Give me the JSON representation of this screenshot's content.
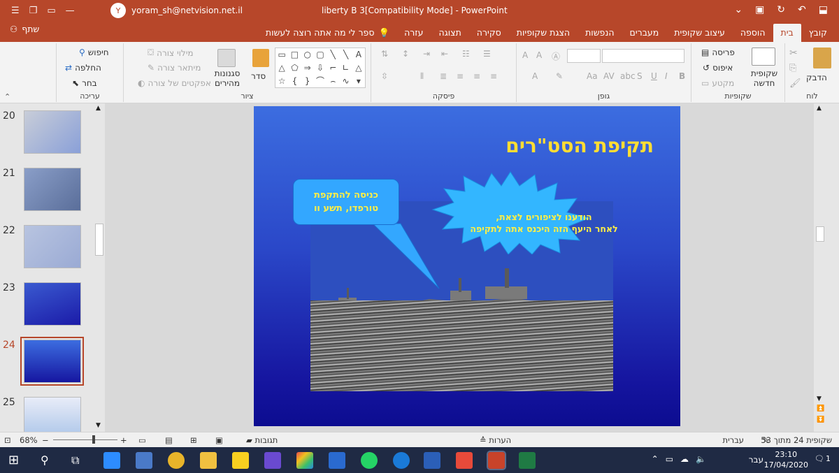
{
  "window": {
    "title": "liberty B 3[Compatibility Mode]  -  PowerPoint",
    "user_initial": "Y",
    "user_email": "yoram_sh@netvision.net.il"
  },
  "ribbon_tabs": [
    "קובץ",
    "בית",
    "הוספה",
    "עיצוב שקופית",
    "מעברים",
    "הנפשות",
    "הצגת שקופיות",
    "סקירה",
    "תצוגה",
    "עזרה"
  ],
  "active_tab": "בית",
  "tell_me": "ספר לי מה אתה רוצה לעשות",
  "share_label": "שתף",
  "groups": {
    "clipboard": {
      "label": "לוח",
      "paste": "הדבק"
    },
    "slides": {
      "label": "שקופיות",
      "new_slide": "שקופית חדשה",
      "layout": "פריסה",
      "reset": "איפוס",
      "section": "מקטע"
    },
    "font": {
      "label": "גופן"
    },
    "paragraph": {
      "label": "פיסקה"
    },
    "drawing": {
      "label": "ציור",
      "arrange": "סדר",
      "quick_styles": "סגנונות מהירים",
      "shape_fill": "מילוי צורה",
      "shape_outline": "מיתאר צורה",
      "shape_effects": "אפקטים של צורה"
    },
    "editing": {
      "label": "עריכה",
      "find": "חיפוש",
      "replace": "החלפה",
      "select": "בחר"
    }
  },
  "thumbnails": [
    {
      "num": "20"
    },
    {
      "num": "21"
    },
    {
      "num": "22"
    },
    {
      "num": "23"
    },
    {
      "num": "24"
    },
    {
      "num": "25"
    }
  ],
  "selected_slide": "24",
  "slide": {
    "title": "תקיפת הסט\"רים",
    "callout_line1": "כניסה להתקפת",
    "callout_line2": "טורפדו, תשע וו",
    "burst_line1": "הודענו לציפורים לצאת,",
    "burst_line2": "לאחר היעף הזה היכנס אתה לתקיפה"
  },
  "status": {
    "slide_counter": "שקופית 24 מתוך 53",
    "language": "עברית",
    "notes": "הערות",
    "comments": "תגובות",
    "zoom": "68%"
  },
  "taskbar": {
    "lang": "עבר",
    "time": "23:10",
    "date": "17/04/2020",
    "notif": "1"
  },
  "colors": {
    "accent": "#b7472a",
    "slide_title": "#ffdd33",
    "callout_fill": "#33a7ff",
    "burst_fill": "#33b6ff"
  }
}
